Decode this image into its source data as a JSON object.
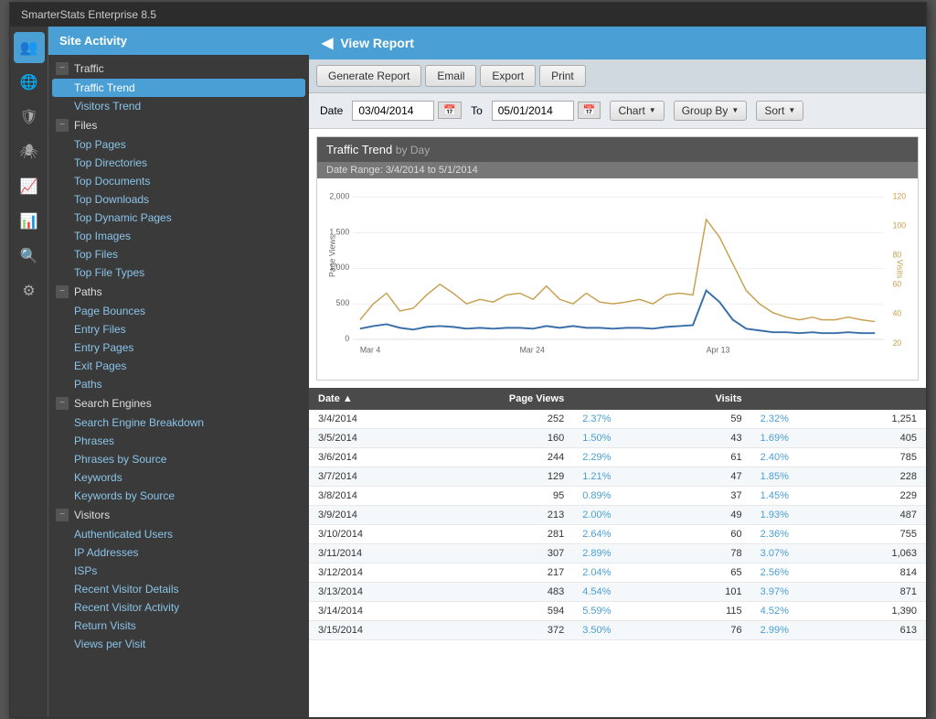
{
  "app": {
    "title": "SmarterStats Enterprise 8.5"
  },
  "sidebar": {
    "header": "Site Activity",
    "sections": [
      {
        "name": "Traffic",
        "items": [
          "Traffic Trend",
          "Visitors Trend"
        ]
      },
      {
        "name": "Files",
        "items": [
          "Top Pages",
          "Top Directories",
          "Top Documents",
          "Top Downloads",
          "Top Dynamic Pages",
          "Top Images",
          "Top Files",
          "Top File Types"
        ]
      },
      {
        "name": "Paths",
        "items": [
          "Page Bounces",
          "Entry Files",
          "Entry Pages",
          "Exit Pages",
          "Paths"
        ]
      },
      {
        "name": "Search Engines",
        "items": [
          "Search Engine Breakdown",
          "Phrases",
          "Phrases by Source",
          "Keywords",
          "Keywords by Source"
        ]
      },
      {
        "name": "Visitors",
        "items": [
          "Authenticated Users",
          "IP Addresses",
          "ISPs",
          "Recent Visitor Details",
          "Recent Visitor Activity",
          "Return Visits",
          "Views per Visit"
        ]
      }
    ],
    "activeItem": "Traffic Trend",
    "icons": [
      "people-icon",
      "globe-icon",
      "shield-icon",
      "spider-icon",
      "chart-icon",
      "bar-icon",
      "search-icon",
      "gear-icon"
    ]
  },
  "content": {
    "header": "View Report",
    "toolbar": {
      "buttons": [
        "Generate Report",
        "Email",
        "Export",
        "Print"
      ]
    },
    "controls": {
      "date_label": "Date",
      "date_from": "03/04/2014",
      "to_label": "To",
      "date_to": "05/01/2014",
      "chart_label": "Chart",
      "group_by_label": "Group By",
      "sort_label": "Sort"
    },
    "chart": {
      "title": "Traffic Trend",
      "subtitle": "by Day",
      "date_range": "Date Range: 3/4/2014 to 5/1/2014",
      "left_axis_label": "Page Views",
      "right_axis_label": "Visits",
      "left_max": 2000,
      "right_max": 120,
      "x_labels": [
        "Mar 4",
        "Mar 24",
        "Apr 13"
      ]
    },
    "table": {
      "columns": [
        "Date",
        "Page Views",
        "",
        "Visits",
        "",
        ""
      ],
      "rows": [
        {
          "date": "3/4/2014",
          "page_views": "252",
          "pv_pct": "2.37%",
          "visits": "59",
          "v_pct": "2.32%",
          "extra": "1,251"
        },
        {
          "date": "3/5/2014",
          "page_views": "160",
          "pv_pct": "1.50%",
          "visits": "43",
          "v_pct": "1.69%",
          "extra": "405"
        },
        {
          "date": "3/6/2014",
          "page_views": "244",
          "pv_pct": "2.29%",
          "visits": "61",
          "v_pct": "2.40%",
          "extra": "785"
        },
        {
          "date": "3/7/2014",
          "page_views": "129",
          "pv_pct": "1.21%",
          "visits": "47",
          "v_pct": "1.85%",
          "extra": "228"
        },
        {
          "date": "3/8/2014",
          "page_views": "95",
          "pv_pct": "0.89%",
          "visits": "37",
          "v_pct": "1.45%",
          "extra": "229"
        },
        {
          "date": "3/9/2014",
          "page_views": "213",
          "pv_pct": "2.00%",
          "visits": "49",
          "v_pct": "1.93%",
          "extra": "487"
        },
        {
          "date": "3/10/2014",
          "page_views": "281",
          "pv_pct": "2.64%",
          "visits": "60",
          "v_pct": "2.36%",
          "extra": "755"
        },
        {
          "date": "3/11/2014",
          "page_views": "307",
          "pv_pct": "2.89%",
          "visits": "78",
          "v_pct": "3.07%",
          "extra": "1,063"
        },
        {
          "date": "3/12/2014",
          "page_views": "217",
          "pv_pct": "2.04%",
          "visits": "65",
          "v_pct": "2.56%",
          "extra": "814"
        },
        {
          "date": "3/13/2014",
          "page_views": "483",
          "pv_pct": "4.54%",
          "visits": "101",
          "v_pct": "3.97%",
          "extra": "871"
        },
        {
          "date": "3/14/2014",
          "page_views": "594",
          "pv_pct": "5.59%",
          "visits": "115",
          "v_pct": "4.52%",
          "extra": "1,390"
        },
        {
          "date": "3/15/2014",
          "page_views": "372",
          "pv_pct": "3.50%",
          "visits": "76",
          "v_pct": "2.99%",
          "extra": "613"
        }
      ]
    }
  }
}
